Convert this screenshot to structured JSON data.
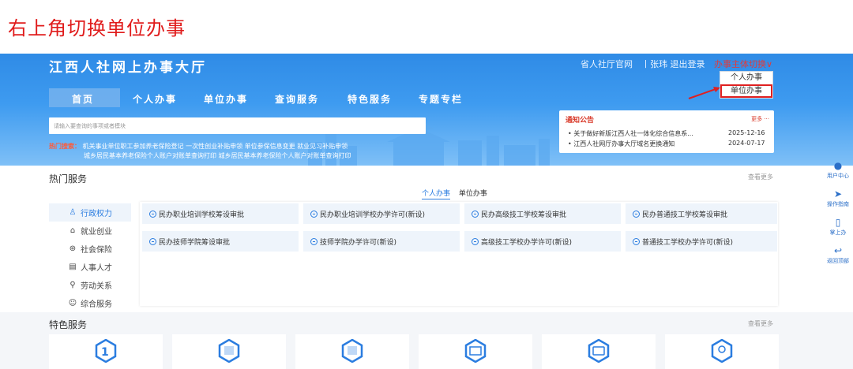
{
  "caption": "右上角切换单位办事",
  "site_title": "江西人社网上办事大厅",
  "toplinks": {
    "official": "省人社厅官网",
    "user": "丨张玮 退出登录",
    "switch": "办事主体切换∨"
  },
  "dropdown": [
    "个人办事",
    "单位办事"
  ],
  "nav": [
    "首页",
    "个人办事",
    "单位办事",
    "查询服务",
    "特色服务",
    "专题专栏"
  ],
  "search": {
    "placeholder": "请输入要查询的事项或者模块"
  },
  "hot_search": {
    "label": "热门搜索：",
    "line1": "机关事业单位职工参加养老保险登记  一次性创业补贴申领  单位参保信息变更  就业见习补贴申领",
    "line2": "城乡居民基本养老保险个人账户对账单查询打印  城乡居民基本养老保险个人账户对账单查询打印"
  },
  "notice": {
    "title": "通知公告",
    "more": "更多 ···",
    "items": [
      {
        "text": "•  关于做好新版江西人社一体化综合信息系...",
        "date": "2025-12-16"
      },
      {
        "text": "•  江西人社网厅办事大厅域名更换通知",
        "date": "2024-07-17"
      }
    ]
  },
  "hot_services": {
    "title": "热门服务",
    "more": "查看更多",
    "tabs": [
      "个人办事",
      "单位办事"
    ],
    "categories": [
      {
        "icon": "♙",
        "label": "行政权力"
      },
      {
        "icon": "⌂",
        "label": "就业创业"
      },
      {
        "icon": "⊛",
        "label": "社会保险"
      },
      {
        "icon": "▤",
        "label": "人事人才"
      },
      {
        "icon": "⚲",
        "label": "劳动关系"
      },
      {
        "icon": "☺",
        "label": "综合服务"
      }
    ],
    "items": [
      "民办职业培训学校筹设审批",
      "民办职业培训学校办学许可(新设)",
      "民办高级技工学校筹设审批",
      "民办普通技工学校筹设审批",
      "民办技师学院筹设审批",
      "技师学院办学许可(新设)",
      "高级技工学校办学许可(新设)",
      "普通技工学校办学许可(新设)"
    ]
  },
  "feature_services": {
    "title": "特色服务",
    "more": "查看更多"
  },
  "sidebar": [
    "用户中心",
    "操作指南",
    "掌上办",
    "返回顶部"
  ],
  "colors": {
    "accent": "#2b7de0",
    "caption": "#e01b1b",
    "header": "#3e9bf0"
  }
}
